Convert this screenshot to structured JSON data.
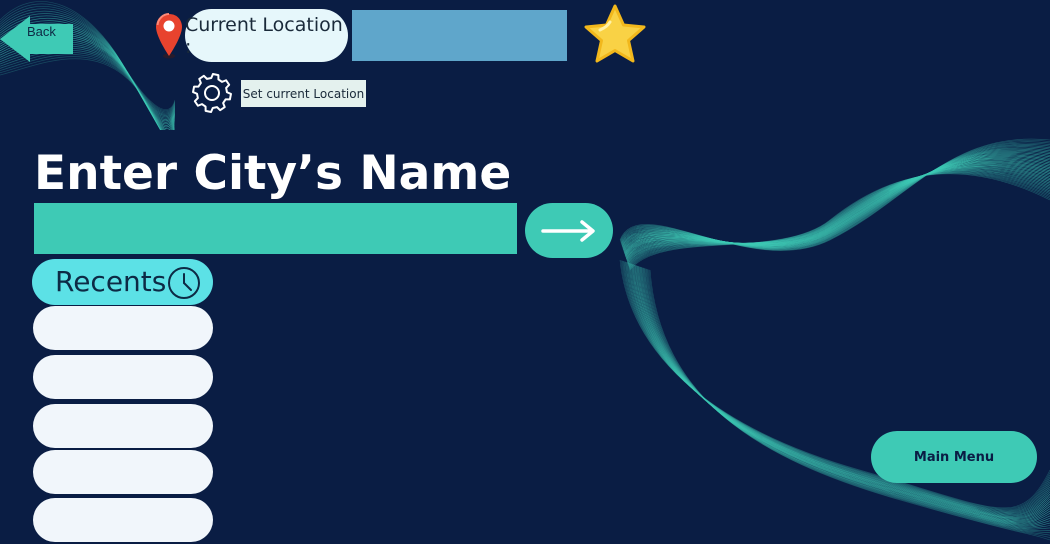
{
  "nav": {
    "back_label": "Back",
    "back_icon": "arrow-left-icon"
  },
  "location": {
    "label": "Current Location :",
    "value": "",
    "pin_icon": "map-pin-icon",
    "favorite_icon": "star-icon"
  },
  "settings": {
    "gear_icon": "gear-icon",
    "set_location_label": "Set current Location"
  },
  "search": {
    "title": "Enter City’s Name",
    "input_value": "",
    "submit_icon": "arrow-right-icon"
  },
  "recents": {
    "label": "Recents",
    "icon": "clock-icon",
    "items": [
      "",
      "",
      "",
      "",
      ""
    ]
  },
  "footer": {
    "main_menu_label": "Main Menu"
  },
  "colors": {
    "background": "#0a1d44",
    "accent_teal": "#3ecab5",
    "accent_cyan": "#5ce1e6",
    "location_value_box": "#5fa6cb",
    "slot_white": "#f1f6fb"
  }
}
